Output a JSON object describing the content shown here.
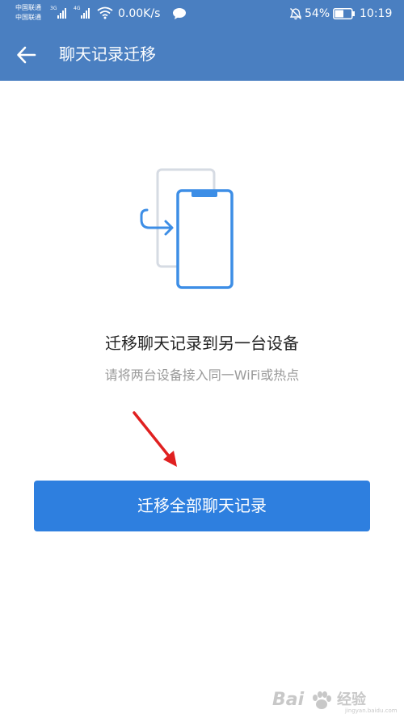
{
  "status_bar": {
    "carrier_1": "中国联通",
    "carrier_2": "中国联通",
    "network_1": "3G",
    "network_2": "4G",
    "speed": "0.00K/s",
    "battery_percent": "54%",
    "battery_level": 0.54,
    "time": "10:19"
  },
  "app_bar": {
    "title": "聊天记录迁移"
  },
  "main": {
    "headline": "迁移聊天记录到另一台设备",
    "subline": "请将两台设备接入同一WiFi或热点",
    "button_label": "迁移全部聊天记录"
  },
  "watermark": {
    "brand": "Bai",
    "brand_suffix": "经验",
    "url": "jingyan.baidu.com"
  },
  "colors": {
    "app_bar": "#4a7fc1",
    "button": "#2e7fdf",
    "illustration_blue": "#3d8ee6",
    "illustration_gray": "#d6dbe3",
    "annotation_arrow": "#e02020"
  }
}
